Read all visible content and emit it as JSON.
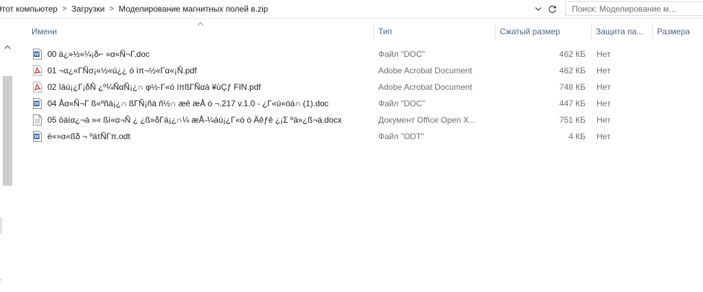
{
  "address": {
    "crumbs": [
      "Этот компьютер",
      "Загрузки",
      "Моделирование магнитных полей в.zip"
    ],
    "separator": ">"
  },
  "search": {
    "placeholder": "Поиск: Моделирование м..."
  },
  "columns": {
    "name": "Имени",
    "type": "Тип",
    "packed_size": "Сжатый размер",
    "protection": "Защита па...",
    "size": "Размера"
  },
  "files": [
    {
      "icon": "doc-file-icon",
      "name": "00 ä¿»½«¼¡δ⌐ »α«Ñ¬Γ.doc",
      "type": "Файл \"DOC\"",
      "packed_size": "462 КБ",
      "protection": "Нет"
    },
    {
      "icon": "pdf-file-icon",
      "name": "01 ¬α¿«ΓÑσ¡«½«ú¿¿ ó ìπ¬½«Γα«¡Ñ.pdf",
      "type": "Adobe Acrobat Document",
      "packed_size": "462 КБ",
      "protection": "Нет"
    },
    {
      "icon": "pdf-file-icon",
      "name": "02 îáú¡¿Γ¡δÑ ¿º¼ÑαÑ¡¿∩ φ½-Γ«ó íπßΓÑαá ¥ùÇƒ FIN.pdf",
      "type": "Adobe Acrobat Document",
      "packed_size": "748 КБ",
      "protection": "Нет"
    },
    {
      "icon": "doc-file-icon",
      "name": "04 Åα«Ñ¬Γ ß«ºñá¡¿∩ ßΓÑ¡ñá ñ½∩ æê æÅ ó ¬.217 v.1.0 - ¿Γ«ú«óá∩ (1).doc",
      "type": "Файл \"DOC\"",
      "packed_size": "447 КБ",
      "protection": "Нет"
    },
    {
      "icon": "docx-file-icon",
      "name": "05 ôáíα¿¬á »« ßí«α¬Ñ ¿ ¿ß»δΓá¡¿∩¼ æÅ-¼áú¡¿Γ«ó ó Äêƒê ¿¡Σ ºá»¿ß¬á.docx",
      "type": "Документ Office Open X...",
      "packed_size": "751 КБ",
      "protection": "Нет"
    },
    {
      "icon": "odt-file-icon",
      "name": "é«»α«ßδ ¬ ºáτÑΓπ.odt",
      "type": "Файл \"ODT\"",
      "packed_size": "4 КБ",
      "protection": "Нет"
    }
  ],
  "colors": {
    "header_text": "#4c607a",
    "muted_text": "#6d6d6d",
    "pdf_red": "#d32f2f",
    "doc_blue": "#2b5797"
  }
}
